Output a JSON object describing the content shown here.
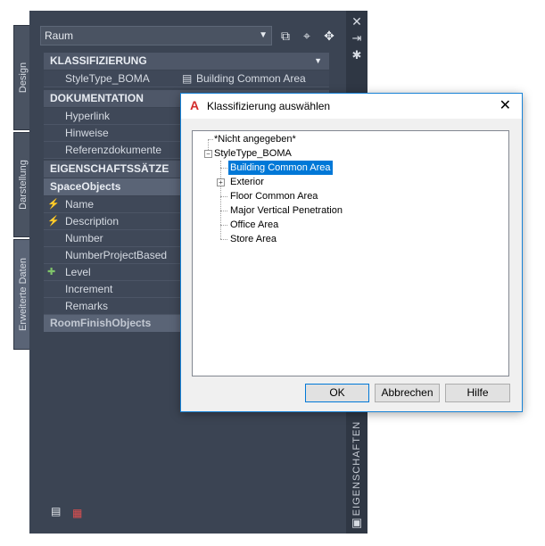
{
  "palette": {
    "combo_value": "Raum",
    "tabs": [
      "Design",
      "Darstellung",
      "Erweiterte Daten"
    ],
    "side_label": "EIGENSCHAFTEN",
    "sections": {
      "klassifizierung": "KLASSIFIZIERUNG",
      "styletype_name": "StyleType_BOMA",
      "styletype_value": "Building Common Area",
      "dokumentation": "DOKUMENTATION",
      "hyperlink": "Hyperlink",
      "hinweise": "Hinweise",
      "referenzdokumente": "Referenzdokumente",
      "eigenschaftssaetze": "EIGENSCHAFTSSÄTZE",
      "spaceobjects": "SpaceObjects",
      "name": "Name",
      "description": "Description",
      "number": "Number",
      "numberprojectbased": "NumberProjectBased",
      "level": "Level",
      "increment": "Increment",
      "remarks": "Remarks",
      "roomfinishobjects": "RoomFinishObjects"
    }
  },
  "dialog": {
    "title": "Klassifizierung auswählen",
    "tree": {
      "not_specified": "*Nicht angegeben*",
      "root": "StyleType_BOMA",
      "children": [
        "Building Common Area",
        "Exterior",
        "Floor Common Area",
        "Major Vertical Penetration",
        "Office Area",
        "Store Area"
      ]
    },
    "buttons": {
      "ok": "OK",
      "cancel": "Abbrechen",
      "help": "Hilfe"
    }
  },
  "colors": {
    "palette_bg": "#3b4453",
    "selection": "#0078d7",
    "dialog_border": "#1883d7"
  }
}
